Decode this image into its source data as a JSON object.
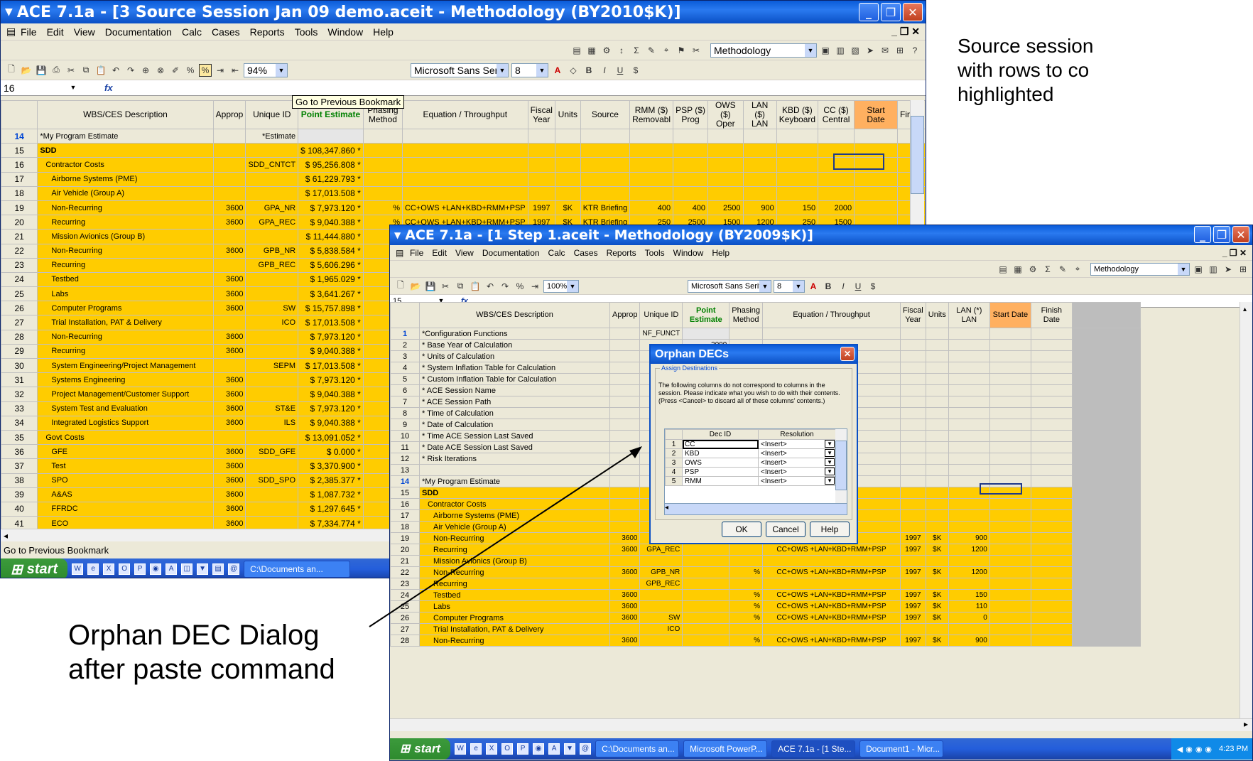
{
  "annotations": {
    "source_note": [
      "Source session",
      "with rows to co",
      "highlighted"
    ],
    "orphan_note": [
      "Orphan DEC Dialog",
      "after paste command"
    ]
  },
  "source": {
    "title": "ACE 7.1a - [3 Source Session Jan 09 demo.aceit - Methodology (BY2010$K)]",
    "menu": [
      "File",
      "Edit",
      "View",
      "Documentation",
      "Calc",
      "Cases",
      "Reports",
      "Tools",
      "Window",
      "Help"
    ],
    "methodology": "Methodology",
    "zoom": "94%",
    "font": "Microsoft Sans Serif",
    "font_size": "8",
    "cell_ref": "16",
    "tooltip": "Go to Previous Bookmark",
    "status": "Go to Previous Bookmark",
    "headers": [
      "WBS/CES Description",
      "Approp",
      "Unique ID",
      "Point Estimate",
      "Phasing Method",
      "Equation / Throughput",
      "Fiscal Year",
      "Units",
      "Source",
      "RMM ($) Removabl",
      "PSP ($) Prog",
      "OWS ($) Oper",
      "LAN ($) LAN",
      "KBD ($) Keyboard",
      "CC ($) Central",
      "Start Date",
      "Finish"
    ],
    "rows": [
      {
        "n": "14",
        "d": "*My Program Estimate",
        "a": "",
        "u": "*Estimate",
        "p": "",
        "ph": "",
        "eq": "",
        "fy": "",
        "un": "",
        "src": "",
        "rmm": "",
        "psp": "",
        "ows": "",
        "lan": "",
        "kbd": "",
        "cc": "",
        "y": false
      },
      {
        "n": "15",
        "d": "SDD",
        "a": "",
        "u": "",
        "p": "$ 108,347.860 *",
        "ph": "",
        "eq": "",
        "fy": "",
        "un": "",
        "src": "",
        "rmm": "",
        "psp": "",
        "ows": "",
        "lan": "",
        "kbd": "",
        "cc": "",
        "y": true
      },
      {
        "n": "16",
        "d": "Contractor Costs",
        "a": "",
        "u": "SDD_CNTCT",
        "p": "$ 95,256.808 *",
        "ph": "",
        "eq": "",
        "fy": "",
        "un": "",
        "src": "",
        "rmm": "",
        "psp": "",
        "ows": "",
        "lan": "",
        "kbd": "",
        "cc": "",
        "y": true
      },
      {
        "n": "17",
        "d": "Airborne Systems (PME)",
        "a": "",
        "u": "",
        "p": "$ 61,229.793 *",
        "ph": "",
        "eq": "",
        "fy": "",
        "un": "",
        "src": "",
        "rmm": "",
        "psp": "",
        "ows": "",
        "lan": "",
        "kbd": "",
        "cc": "",
        "y": true
      },
      {
        "n": "18",
        "d": "Air Vehicle (Group A)",
        "a": "",
        "u": "",
        "p": "$ 17,013.508 *",
        "ph": "",
        "eq": "",
        "fy": "",
        "un": "",
        "src": "",
        "rmm": "",
        "psp": "",
        "ows": "",
        "lan": "",
        "kbd": "",
        "cc": "",
        "y": true
      },
      {
        "n": "19",
        "d": "Non-Recurring",
        "a": "3600",
        "u": "GPA_NR",
        "p": "$ 7,973.120 *",
        "ph": "%",
        "eq": "CC+OWS +LAN+KBD+RMM+PSP",
        "fy": "1997",
        "un": "$K",
        "src": "KTR Briefing",
        "rmm": "400",
        "psp": "400",
        "ows": "2500",
        "lan": "900",
        "kbd": "150",
        "cc": "2000",
        "y": true
      },
      {
        "n": "20",
        "d": "Recurring",
        "a": "3600",
        "u": "GPA_REC",
        "p": "$ 9,040.388 *",
        "ph": "%",
        "eq": "CC+OWS +LAN+KBD+RMM+PSP",
        "fy": "1997",
        "un": "$K",
        "src": "KTR Briefing",
        "rmm": "250",
        "psp": "2500",
        "ows": "1500",
        "lan": "1200",
        "kbd": "250",
        "cc": "1500",
        "y": true
      },
      {
        "n": "21",
        "d": "Mission Avionics (Group B)",
        "a": "",
        "u": "",
        "p": "$ 11,444.880 *",
        "ph": "",
        "eq": "",
        "fy": "",
        "un": "",
        "src": "",
        "rmm": "",
        "psp": "",
        "ows": "",
        "lan": "",
        "kbd": "",
        "cc": "",
        "y": true
      },
      {
        "n": "22",
        "d": "Non-Recurring",
        "a": "3600",
        "u": "GPB_NR",
        "p": "$ 5,838.584 *",
        "ph": "%",
        "eq": "",
        "fy": "",
        "un": "",
        "src": "",
        "rmm": "",
        "psp": "",
        "ows": "",
        "lan": "",
        "kbd": "",
        "cc": "",
        "y": true
      },
      {
        "n": "23",
        "d": "Recurring",
        "a": "",
        "u": "GPB_REC",
        "p": "$ 5,606.296 *",
        "ph": "",
        "eq": "",
        "fy": "",
        "un": "",
        "src": "",
        "rmm": "",
        "psp": "",
        "ows": "",
        "lan": "",
        "kbd": "",
        "cc": "",
        "y": true
      },
      {
        "n": "24",
        "d": "Testbed",
        "a": "3600",
        "u": "",
        "p": "$ 1,965.029 *",
        "ph": "%",
        "eq": "",
        "fy": "",
        "un": "",
        "src": "",
        "rmm": "",
        "psp": "",
        "ows": "",
        "lan": "",
        "kbd": "",
        "cc": "",
        "y": true
      },
      {
        "n": "25",
        "d": "Labs",
        "a": "3600",
        "u": "",
        "p": "$ 3,641.267 *",
        "ph": "%",
        "eq": "",
        "fy": "",
        "un": "",
        "src": "",
        "rmm": "",
        "psp": "",
        "ows": "",
        "lan": "",
        "kbd": "",
        "cc": "",
        "y": true
      },
      {
        "n": "26",
        "d": "Computer Programs",
        "a": "3600",
        "u": "SW",
        "p": "$ 15,757.898 *",
        "ph": "%",
        "eq": "",
        "fy": "",
        "un": "",
        "src": "",
        "rmm": "",
        "psp": "",
        "ows": "",
        "lan": "",
        "kbd": "",
        "cc": "",
        "y": true
      },
      {
        "n": "27",
        "d": "Trial Installation, PAT & Delivery",
        "a": "",
        "u": "ICO",
        "p": "$ 17,013.508 *",
        "ph": "",
        "eq": "",
        "fy": "",
        "un": "",
        "src": "",
        "rmm": "",
        "psp": "",
        "ows": "",
        "lan": "",
        "kbd": "",
        "cc": "",
        "y": true
      },
      {
        "n": "28",
        "d": "Non-Recurring",
        "a": "3600",
        "u": "",
        "p": "$ 7,973.120 *",
        "ph": "%",
        "eq": "",
        "fy": "",
        "un": "",
        "src": "",
        "rmm": "",
        "psp": "",
        "ows": "",
        "lan": "",
        "kbd": "",
        "cc": "",
        "y": true
      },
      {
        "n": "29",
        "d": "Recurring",
        "a": "3600",
        "u": "",
        "p": "$ 9,040.388 *",
        "ph": "%",
        "eq": "",
        "fy": "",
        "un": "",
        "src": "",
        "rmm": "",
        "psp": "",
        "ows": "",
        "lan": "",
        "kbd": "",
        "cc": "",
        "y": true
      },
      {
        "n": "30",
        "d": "System Engineering/Project Management",
        "a": "",
        "u": "SEPM",
        "p": "$ 17,013.508 *",
        "ph": "",
        "eq": "",
        "fy": "",
        "un": "",
        "src": "",
        "rmm": "",
        "psp": "",
        "ows": "",
        "lan": "",
        "kbd": "",
        "cc": "",
        "y": true
      },
      {
        "n": "31",
        "d": "Systems Engineering",
        "a": "3600",
        "u": "",
        "p": "$ 7,973.120 *",
        "ph": "%",
        "eq": "",
        "fy": "",
        "un": "",
        "src": "",
        "rmm": "",
        "psp": "",
        "ows": "",
        "lan": "",
        "kbd": "",
        "cc": "",
        "y": true
      },
      {
        "n": "32",
        "d": "Project Management/Customer Support",
        "a": "3600",
        "u": "",
        "p": "$ 9,040.388 *",
        "ph": "%",
        "eq": "",
        "fy": "",
        "un": "",
        "src": "",
        "rmm": "",
        "psp": "",
        "ows": "",
        "lan": "",
        "kbd": "",
        "cc": "",
        "y": true
      },
      {
        "n": "33",
        "d": "System Test and Evaluation",
        "a": "3600",
        "u": "ST&E",
        "p": "$ 7,973.120 *",
        "ph": "%",
        "eq": "",
        "fy": "",
        "un": "",
        "src": "",
        "rmm": "",
        "psp": "",
        "ows": "",
        "lan": "",
        "kbd": "",
        "cc": "",
        "y": true
      },
      {
        "n": "34",
        "d": "Integrated Logistics Support",
        "a": "3600",
        "u": "ILS",
        "p": "$ 9,040.388 *",
        "ph": "%",
        "eq": "",
        "fy": "",
        "un": "",
        "src": "",
        "rmm": "",
        "psp": "",
        "ows": "",
        "lan": "",
        "kbd": "",
        "cc": "",
        "y": true
      },
      {
        "n": "35",
        "d": "Govt Costs",
        "a": "",
        "u": "",
        "p": "$ 13,091.052 *",
        "ph": "",
        "eq": "",
        "fy": "",
        "un": "",
        "src": "",
        "rmm": "",
        "psp": "",
        "ows": "",
        "lan": "",
        "kbd": "",
        "cc": "",
        "y": true
      },
      {
        "n": "36",
        "d": "GFE",
        "a": "3600",
        "u": "SDD_GFE",
        "p": "$ 0.000 *",
        "ph": "F",
        "eq": "",
        "fy": "",
        "un": "",
        "src": "",
        "rmm": "",
        "psp": "",
        "ows": "",
        "lan": "",
        "kbd": "",
        "cc": "",
        "y": true
      },
      {
        "n": "37",
        "d": "Test",
        "a": "3600",
        "u": "",
        "p": "$ 3,370.900 *",
        "ph": "F",
        "eq": "",
        "fy": "",
        "un": "",
        "src": "",
        "rmm": "",
        "psp": "",
        "ows": "",
        "lan": "",
        "kbd": "",
        "cc": "",
        "y": true
      },
      {
        "n": "38",
        "d": "SPO",
        "a": "3600",
        "u": "SDD_SPO",
        "p": "$ 2,385.377 *",
        "ph": "F",
        "eq": "",
        "fy": "",
        "un": "",
        "src": "",
        "rmm": "",
        "psp": "",
        "ows": "",
        "lan": "",
        "kbd": "",
        "cc": "",
        "y": true
      },
      {
        "n": "39",
        "d": "A&AS",
        "a": "3600",
        "u": "",
        "p": "$ 1,087.732 *",
        "ph": "F",
        "eq": "",
        "fy": "",
        "un": "",
        "src": "",
        "rmm": "",
        "psp": "",
        "ows": "",
        "lan": "",
        "kbd": "",
        "cc": "",
        "y": true
      },
      {
        "n": "40",
        "d": "FFRDC",
        "a": "3600",
        "u": "",
        "p": "$ 1,297.645 *",
        "ph": "F",
        "eq": "",
        "fy": "",
        "un": "",
        "src": "",
        "rmm": "",
        "psp": "",
        "ows": "",
        "lan": "",
        "kbd": "",
        "cc": "",
        "y": true
      },
      {
        "n": "41",
        "d": "ECO",
        "a": "3600",
        "u": "",
        "p": "$ 7,334.774 *",
        "ph": "F",
        "eq": "",
        "fy": "",
        "un": "",
        "src": "",
        "rmm": "",
        "psp": "",
        "ows": "",
        "lan": "",
        "kbd": "",
        "cc": "",
        "y": true
      }
    ],
    "taskbar": {
      "start": "start",
      "item": "C:\\Documents an..."
    }
  },
  "step": {
    "title": "ACE 7.1a - [1 Step 1.aceit - Methodology (BY2009$K)]",
    "methodology": "Methodology",
    "zoom": "100%",
    "font": "Microsoft Sans Serif",
    "font_size": "8",
    "cell_ref": "15",
    "headers": [
      "WBS/CES Description",
      "Approp",
      "Unique ID",
      "Point Estimate",
      "Phasing Method",
      "Equation / Throughput",
      "Fiscal Year",
      "Units",
      "LAN (*) LAN",
      "Start Date",
      "Finish Date"
    ],
    "rows": [
      {
        "n": "1",
        "d": "*Configuration Functions",
        "a": "",
        "u": "NF_FUNCT",
        "ph": "",
        "eq": "",
        "fy": "",
        "un": "",
        "lan": "",
        "y": false
      },
      {
        "n": "2",
        "d": "* Base Year of Calculation",
        "a": "",
        "u": "",
        "pe": "2009",
        "ph": "",
        "eq": "",
        "fy": "",
        "un": "",
        "lan": "",
        "y": false
      },
      {
        "n": "3",
        "d": "* Units of Calculation",
        "a": "",
        "u": "",
        "ph": "",
        "eq": "",
        "fy": "",
        "un": "",
        "lan": "",
        "y": false
      },
      {
        "n": "4",
        "d": "* System Inflation Table for Calculation",
        "a": "",
        "u": "",
        "ph": "",
        "eq": "",
        "fy": "",
        "un": "",
        "lan": "",
        "y": false
      },
      {
        "n": "5",
        "d": "* Custom Inflation Table for Calculation",
        "a": "",
        "u": "",
        "ph": "",
        "eq": "",
        "fy": "",
        "un": "",
        "lan": "",
        "y": false
      },
      {
        "n": "6",
        "d": "* ACE Session Name",
        "a": "",
        "u": "",
        "ph": "",
        "eq": "",
        "fy": "",
        "un": "",
        "lan": "",
        "y": false
      },
      {
        "n": "7",
        "d": "* ACE Session Path",
        "a": "",
        "u": "",
        "ph": "",
        "eq": "",
        "fy": "",
        "un": "",
        "lan": "",
        "y": false
      },
      {
        "n": "8",
        "d": "* Time of Calculation",
        "a": "",
        "u": "",
        "ph": "",
        "eq": "",
        "fy": "",
        "un": "",
        "lan": "",
        "y": false
      },
      {
        "n": "9",
        "d": "* Date of Calculation",
        "a": "",
        "u": "",
        "ph": "",
        "eq": "",
        "fy": "",
        "un": "",
        "lan": "",
        "y": false
      },
      {
        "n": "10",
        "d": "* Time ACE Session Last Saved",
        "a": "",
        "u": "",
        "ph": "",
        "eq": "",
        "fy": "",
        "un": "",
        "lan": "",
        "y": false
      },
      {
        "n": "11",
        "d": "* Date ACE Session Last Saved",
        "a": "",
        "u": "",
        "ph": "",
        "eq": "",
        "fy": "",
        "un": "",
        "lan": "",
        "y": false
      },
      {
        "n": "12",
        "d": "* Risk Iterations",
        "a": "",
        "u": "",
        "ph": "",
        "eq": "",
        "fy": "",
        "un": "",
        "lan": "",
        "y": false
      },
      {
        "n": "13",
        "d": "",
        "a": "",
        "u": "",
        "ph": "",
        "eq": "",
        "fy": "",
        "un": "",
        "lan": "",
        "y": false
      },
      {
        "n": "14",
        "d": "*My Program Estimate",
        "a": "",
        "u": "*E",
        "ph": "",
        "eq": "",
        "fy": "",
        "un": "",
        "lan": "",
        "y": false
      },
      {
        "n": "15",
        "d": "SDD",
        "a": "",
        "u": "",
        "ph": "",
        "eq": "",
        "fy": "",
        "un": "",
        "lan": "",
        "y": true
      },
      {
        "n": "16",
        "d": "Contractor Costs",
        "a": "",
        "u": "SDD",
        "ph": "",
        "eq": "",
        "fy": "",
        "un": "",
        "lan": "",
        "y": true
      },
      {
        "n": "17",
        "d": "Airborne Systems (PME)",
        "a": "",
        "u": "",
        "ph": "",
        "eq": "",
        "fy": "",
        "un": "",
        "lan": "",
        "y": true
      },
      {
        "n": "18",
        "d": "Air Vehicle (Group A)",
        "a": "",
        "u": "",
        "ph": "",
        "eq": "",
        "fy": "",
        "un": "",
        "lan": "",
        "y": true
      },
      {
        "n": "19",
        "d": "Non-Recurring",
        "a": "3600",
        "u": "",
        "ph": "",
        "eq": "RMM+PSP",
        "fy": "1997",
        "un": "$K",
        "lan": "900",
        "y": true
      },
      {
        "n": "20",
        "d": "Recurring",
        "a": "3600",
        "u": "GPA_REC",
        "ph": "",
        "eq": "CC+OWS +LAN+KBD+RMM+PSP",
        "fy": "1997",
        "un": "$K",
        "lan": "1200",
        "y": true
      },
      {
        "n": "21",
        "d": "Mission Avionics (Group B)",
        "a": "",
        "u": "",
        "ph": "",
        "eq": "",
        "fy": "",
        "un": "",
        "lan": "",
        "y": true
      },
      {
        "n": "22",
        "d": "Non-Recurring",
        "a": "3600",
        "u": "GPB_NR",
        "ph": "%",
        "eq": "CC+OWS +LAN+KBD+RMM+PSP",
        "fy": "1997",
        "un": "$K",
        "lan": "1200",
        "y": true
      },
      {
        "n": "23",
        "d": "Recurring",
        "a": "",
        "u": "GPB_REC",
        "ph": "",
        "eq": "",
        "fy": "",
        "un": "",
        "lan": "",
        "y": true
      },
      {
        "n": "24",
        "d": "Testbed",
        "a": "3600",
        "u": "",
        "ph": "%",
        "eq": "CC+OWS +LAN+KBD+RMM+PSP",
        "fy": "1997",
        "un": "$K",
        "lan": "150",
        "y": true
      },
      {
        "n": "25",
        "d": "Labs",
        "a": "3600",
        "u": "",
        "ph": "%",
        "eq": "CC+OWS +LAN+KBD+RMM+PSP",
        "fy": "1997",
        "un": "$K",
        "lan": "110",
        "y": true
      },
      {
        "n": "26",
        "d": "Computer Programs",
        "a": "3600",
        "u": "SW",
        "ph": "%",
        "eq": "CC+OWS +LAN+KBD+RMM+PSP",
        "fy": "1997",
        "un": "$K",
        "lan": "0",
        "y": true
      },
      {
        "n": "27",
        "d": "Trial Installation, PAT & Delivery",
        "a": "",
        "u": "ICO",
        "ph": "",
        "eq": "",
        "fy": "",
        "un": "",
        "lan": "",
        "y": true
      },
      {
        "n": "28",
        "d": "Non-Recurring",
        "a": "3600",
        "u": "",
        "ph": "%",
        "eq": "CC+OWS +LAN+KBD+RMM+PSP",
        "fy": "1997",
        "un": "$K",
        "lan": "900",
        "y": true
      }
    ],
    "taskbar": [
      "start",
      "C:\\Documents an...",
      "Microsoft PowerP...",
      "ACE 7.1a - [1 Ste...",
      "Document1 - Micr...",
      "4:23 PM"
    ]
  },
  "dialog": {
    "title": "Orphan DECs",
    "group": "Assign Destinations",
    "message": "The following columns do not correspond to columns in the session. Please indicate what you wish to do with their contents. (Press <Cancel> to discard all of these columns' contents.)",
    "col_dec": "Dec ID",
    "col_res": "Resolution",
    "rows": [
      {
        "n": "1",
        "id": "CC",
        "res": "<Insert>"
      },
      {
        "n": "2",
        "id": "KBD",
        "res": "<Insert>"
      },
      {
        "n": "3",
        "id": "OWS",
        "res": "<Insert>"
      },
      {
        "n": "4",
        "id": "PSP",
        "res": "<Insert>"
      },
      {
        "n": "5",
        "id": "RMM",
        "res": "<Insert>"
      }
    ],
    "ok": "OK",
    "cancel": "Cancel",
    "help": "Help"
  }
}
